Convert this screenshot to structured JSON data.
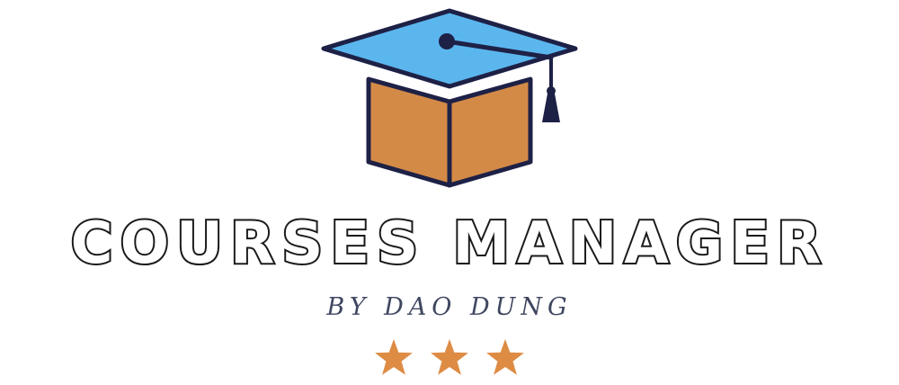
{
  "logo": {
    "title": "COURSES MANAGER",
    "subtitle": "BY DAO DUNG",
    "icon": "graduation-cap-icon",
    "star_icon": "star-icon",
    "star_count": 3,
    "colors": {
      "cap_top": "#5bb6ee",
      "box": "#d48a47",
      "outline": "#1e2146",
      "star": "#de8b44",
      "subtitle": "#3f4660",
      "title_stroke": "#1a1a1a"
    }
  }
}
